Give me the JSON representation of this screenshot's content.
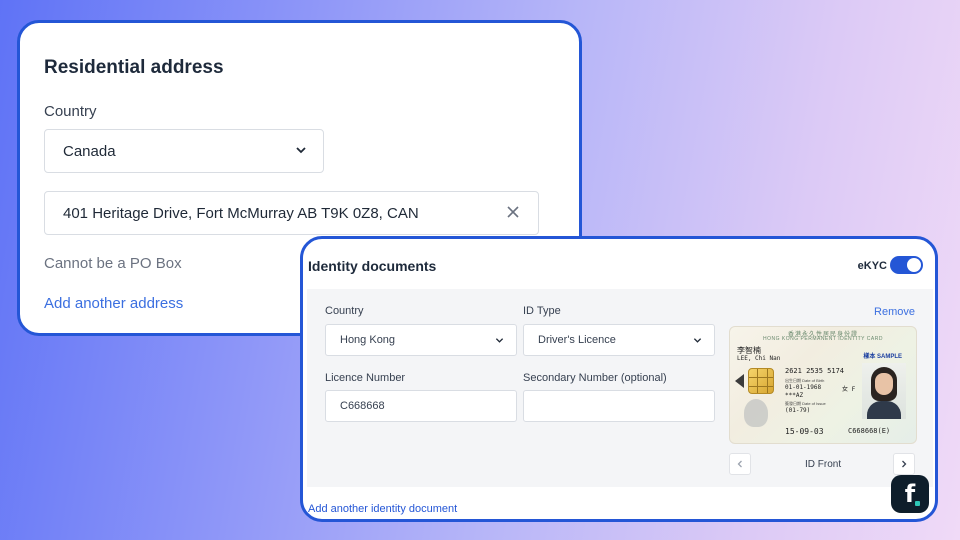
{
  "residential": {
    "title": "Residential address",
    "country_label": "Country",
    "country_value": "Canada",
    "address_value": "401 Heritage Drive, Fort McMurray AB T9K 0Z8, CAN",
    "hint": "Cannot be a PO Box",
    "add_link": "Add another address"
  },
  "identity": {
    "title": "Identity documents",
    "ekyc_label": "eKYC",
    "ekyc_enabled": true,
    "remove_label": "Remove",
    "country_label": "Country",
    "country_value": "Hong Kong",
    "idtype_label": "ID Type",
    "idtype_value": "Driver's Licence",
    "licence_label": "Licence Number",
    "licence_value": "C668668",
    "secondary_label": "Secondary Number (optional)",
    "secondary_value": "",
    "image_caption": "ID Front",
    "add_link": "Add another identity document"
  },
  "id_card": {
    "header_cn": "香港永久性居民身份證",
    "header_en": "HONG KONG PERMANENT IDENTITY CARD",
    "name_cn": "李智楠",
    "name_en": "LEE, Chi Nan",
    "sample": "樣本 SAMPLE",
    "code": "2621 2535 5174",
    "dob_label": "出生日期 Date of Birth",
    "dob": "01-01-1968",
    "sex": "女 F",
    "symbols": "***AZ",
    "issue_label": "簽發日期 Date of Issue",
    "issue_code": "(01-79)",
    "issue_date": "15-09-03",
    "card_no": "C668668(E)"
  },
  "colors": {
    "accent": "#2456d6",
    "link": "#3b6fe0",
    "panel": "#f4f5f7"
  },
  "icons": {
    "dropdown": "chevron-down-icon",
    "clear": "close-icon",
    "prev": "chevron-left-icon",
    "next": "chevron-right-icon",
    "brand": "brand-logo-icon"
  },
  "brand": {
    "letter": "f"
  }
}
